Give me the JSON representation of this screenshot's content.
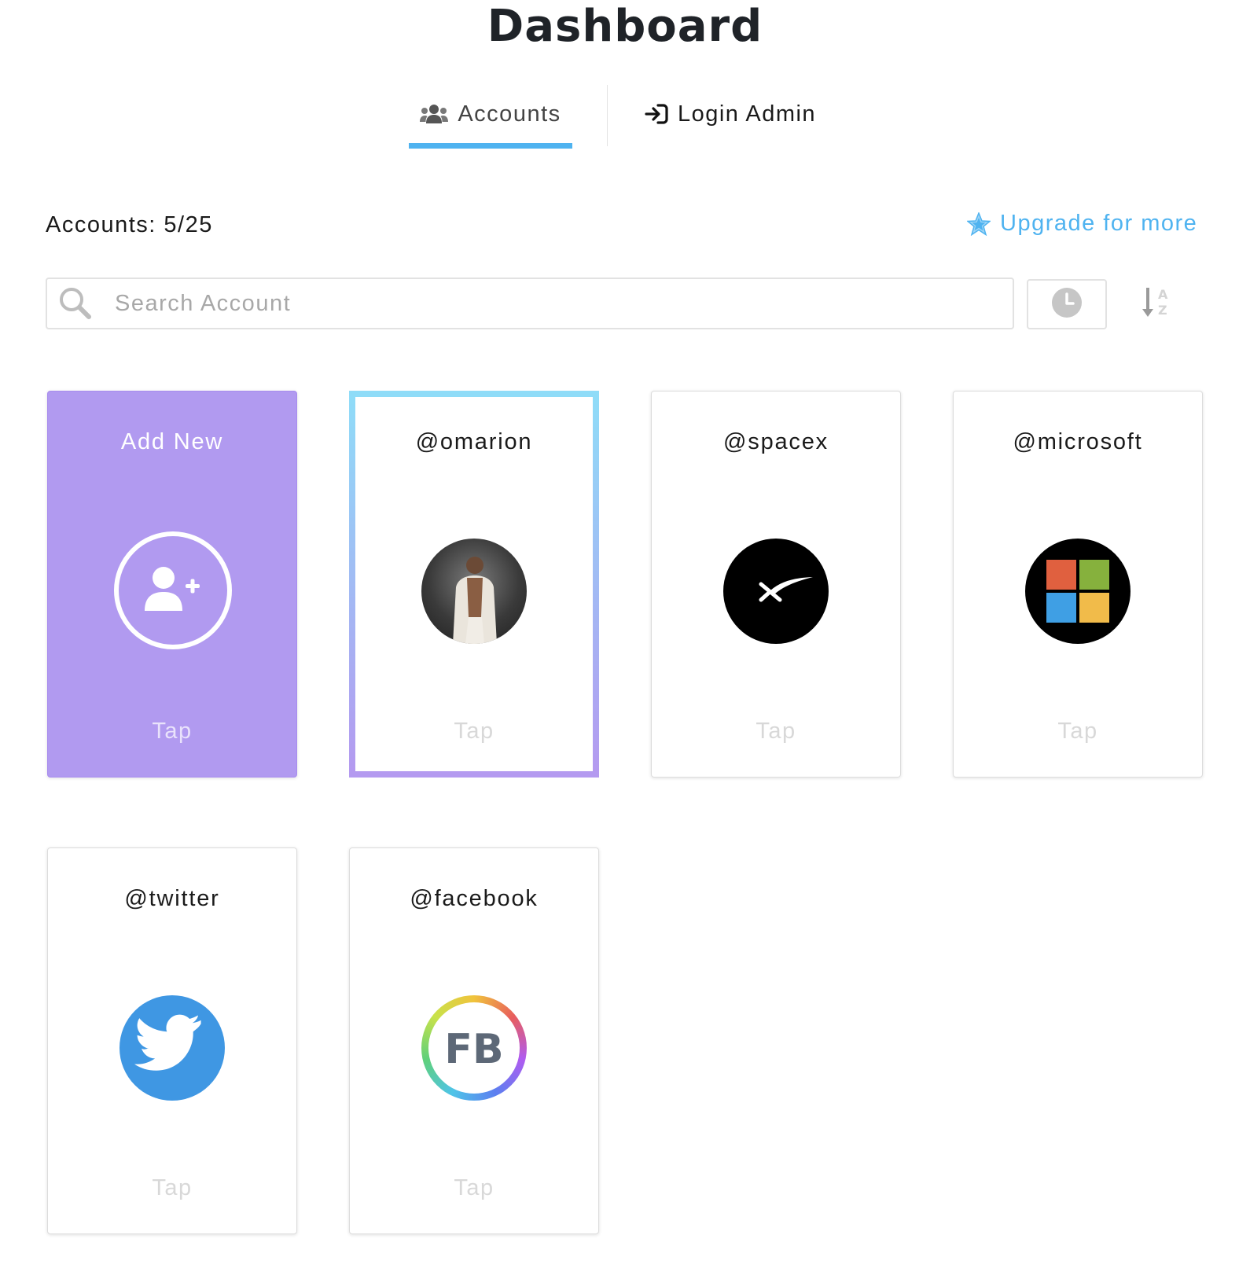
{
  "page": {
    "title": "Dashboard"
  },
  "tabs": [
    {
      "label": "Accounts",
      "icon": "users-icon",
      "active": true
    },
    {
      "label": "Login Admin",
      "icon": "sign-in-icon",
      "active": false
    }
  ],
  "summary": {
    "accounts_count": "Accounts: 5/25",
    "upgrade_label": "Upgrade for more",
    "upgrade_icon": "star-icon"
  },
  "search": {
    "placeholder": "Search Account",
    "value": ""
  },
  "toolbar": {
    "recent_icon": "clock-icon",
    "sort_icon": "sort-alpha-down-icon"
  },
  "add_card": {
    "label": "Add New",
    "tap": "Tap",
    "icon": "user-plus-icon"
  },
  "accounts": [
    {
      "handle": "@omarion",
      "tap": "Tap",
      "avatar": "person-photo",
      "selected": true
    },
    {
      "handle": "@spacex",
      "tap": "Tap",
      "avatar": "spacex-logo"
    },
    {
      "handle": "@microsoft",
      "tap": "Tap",
      "avatar": "microsoft-logo"
    },
    {
      "handle": "@twitter",
      "tap": "Tap",
      "avatar": "twitter-bird-logo"
    },
    {
      "handle": "@facebook",
      "tap": "Tap",
      "avatar": "fb-logo",
      "avatar_text": "FB"
    }
  ],
  "colors": {
    "accent": "#4fb3f0",
    "add_card_bg": "#b19af0",
    "tap_text": "#d8d8d8"
  }
}
